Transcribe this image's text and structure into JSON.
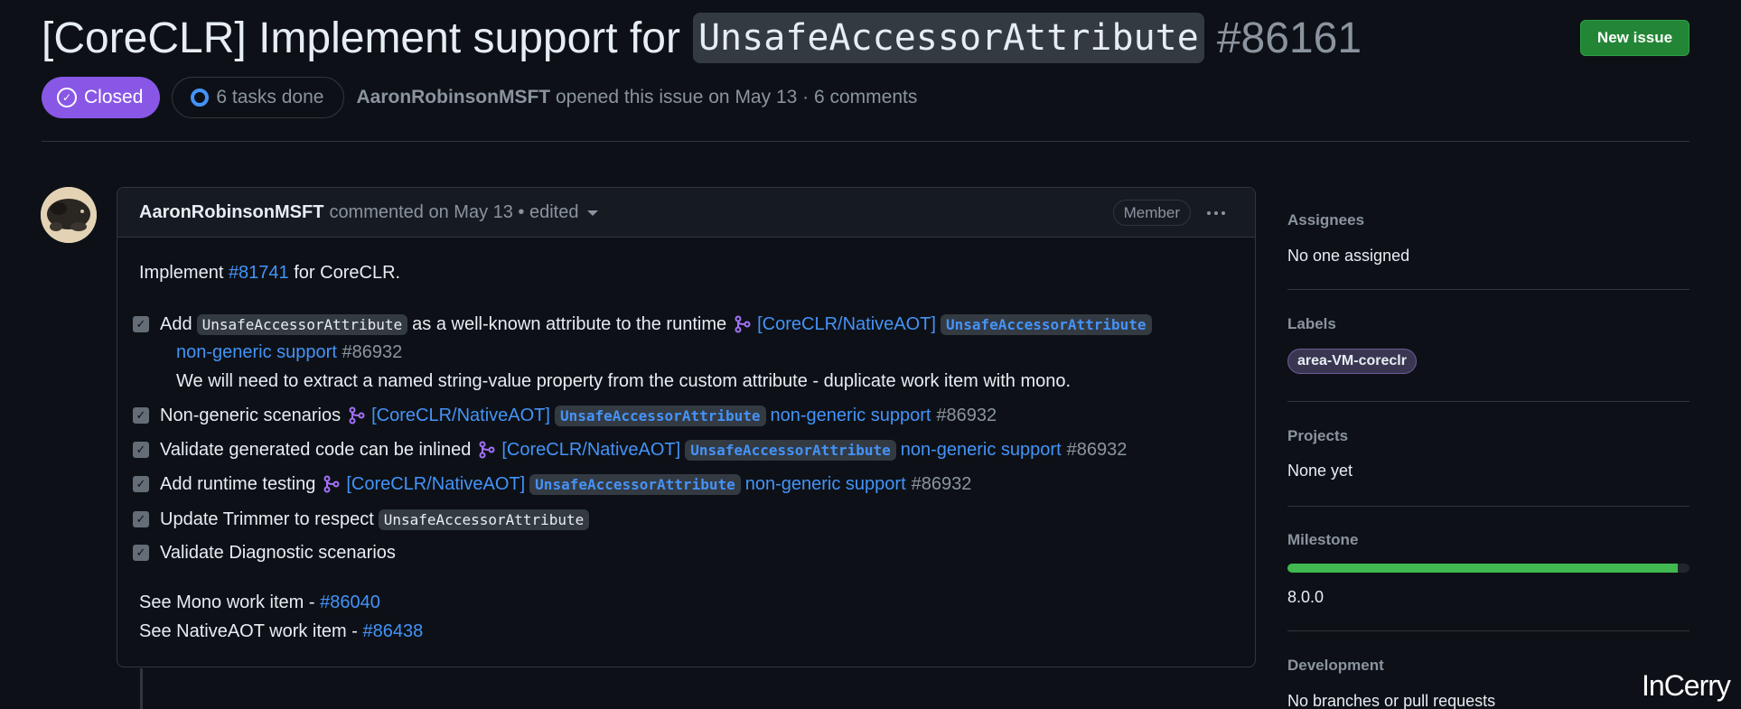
{
  "issue": {
    "title_prefix": "[CoreCLR] Implement support for",
    "title_code": "UnsafeAccessorAttribute",
    "number": "#86161",
    "new_issue_label": "New issue",
    "state": "Closed",
    "tasks": "6 tasks done",
    "author": "AaronRobinsonMSFT",
    "meta_rest": "opened this issue on May 13 · 6 comments"
  },
  "comment": {
    "author": "AaronRobinsonMSFT",
    "meta": "commented on May 13 • edited",
    "role_badge": "Member",
    "intro_prefix": "Implement",
    "intro_link": "#81741",
    "intro_suffix": "for CoreCLR.",
    "pr_link_prefix": "[CoreCLR/NativeAOT]",
    "pr_link_code": "UnsafeAccessorAttribute",
    "pr_link_suffix": "non-generic support",
    "pr_number": "#86932",
    "tasks": [
      {
        "pre": "Add",
        "code": "UnsafeAccessorAttribute",
        "post": "as a well-known attribute to the runtime",
        "checked": true
      },
      {
        "text": "Non-generic scenarios",
        "checked": true
      },
      {
        "text": "Validate generated code can be inlined",
        "checked": true
      },
      {
        "text": "Add runtime testing",
        "checked": true
      },
      {
        "text": "Update Trimmer to respect",
        "code": "UnsafeAccessorAttribute",
        "checked": true
      },
      {
        "text": "Validate Diagnostic scenarios",
        "checked": true
      }
    ],
    "task1_note": "We will need to extract a named string-value property from the custom attribute - duplicate work item with mono.",
    "see_mono_text": "See Mono work item -",
    "see_mono_link": "#86040",
    "see_aot_text": "See NativeAOT work item -",
    "see_aot_link": "#86438"
  },
  "sidebar": {
    "assignees_label": "Assignees",
    "assignees_value": "No one assigned",
    "labels_label": "Labels",
    "label_pill": "area-VM-coreclr",
    "projects_label": "Projects",
    "projects_value": "None yet",
    "milestone_label": "Milestone",
    "milestone_value": "8.0.0",
    "milestone_progress": 0.97,
    "development_label": "Development",
    "development_value": "No branches or pull requests"
  },
  "watermark": "InCerry",
  "colors": {
    "closed": "#8957e5",
    "link": "#4493f8",
    "new_issue": "#238636",
    "progress": "#3fb950"
  }
}
